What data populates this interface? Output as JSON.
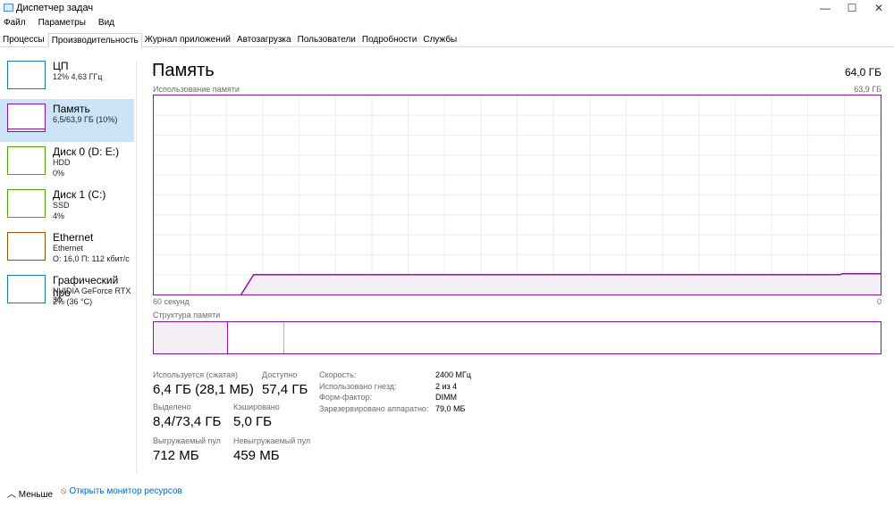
{
  "window": {
    "title": "Диспетчер задач",
    "minimize": "—",
    "maximize": "☐",
    "close": "✕"
  },
  "menu": [
    "Файл",
    "Параметры",
    "Вид"
  ],
  "tabs": [
    "Процессы",
    "Производительность",
    "Журнал приложений",
    "Автозагрузка",
    "Пользователи",
    "Подробности",
    "Службы"
  ],
  "sidebar": [
    {
      "name": "ЦП",
      "line1": "12%  4,63 ГГц",
      "line2": "",
      "color": "#117dbb"
    },
    {
      "name": "Память",
      "line1": "6,5/63,9 ГБ (10%)",
      "line2": "",
      "color": "#8b12ae"
    },
    {
      "name": "Диск 0 (D: E:)",
      "line1": "HDD",
      "line2": "0%",
      "color": "#4da60c"
    },
    {
      "name": "Диск 1 (C:)",
      "line1": "SSD",
      "line2": "4%",
      "color": "#4da60c"
    },
    {
      "name": "Ethernet",
      "line1": "Ethernet",
      "line2": "О: 16,0 П: 112 кбит/с",
      "color": "#a74f01"
    },
    {
      "name": "Графический про",
      "line1": "NVIDIA GeForce RTX 30",
      "line2": "2%  (36 °C)",
      "color": "#117dbb"
    }
  ],
  "main": {
    "title": "Память",
    "total": "64,0 ГБ",
    "graph_label": "Использование памяти",
    "graph_max": "63,9 ГБ",
    "time_left": "60 секунд",
    "time_right": "0",
    "usage_percent": 10,
    "struct_label": "Структура памяти",
    "stats": [
      {
        "label": "Используется (сжатая)",
        "value": "6,4 ГБ (28,1 МБ)"
      },
      {
        "label": "Доступно",
        "value": "57,4 ГБ"
      },
      {
        "label": "Выделено",
        "value": "8,4/73,4 ГБ"
      },
      {
        "label": "Кэшировано",
        "value": "5,0 ГБ"
      },
      {
        "label": "Выгружаемый пул",
        "value": "712 МБ"
      },
      {
        "label": "Невыгружаемый пул",
        "value": "459 МБ"
      }
    ],
    "props": [
      {
        "k": "Скорость:",
        "v": "2400 МГц"
      },
      {
        "k": "Использовано гнезд:",
        "v": "2 из 4"
      },
      {
        "k": "Форм-фактор:",
        "v": "DIMM"
      },
      {
        "k": "Зарезервировано аппаратно:",
        "v": "79,0 МБ"
      }
    ]
  },
  "footer": {
    "less": "Меньше",
    "monitor": "Открыть монитор ресурсов"
  }
}
